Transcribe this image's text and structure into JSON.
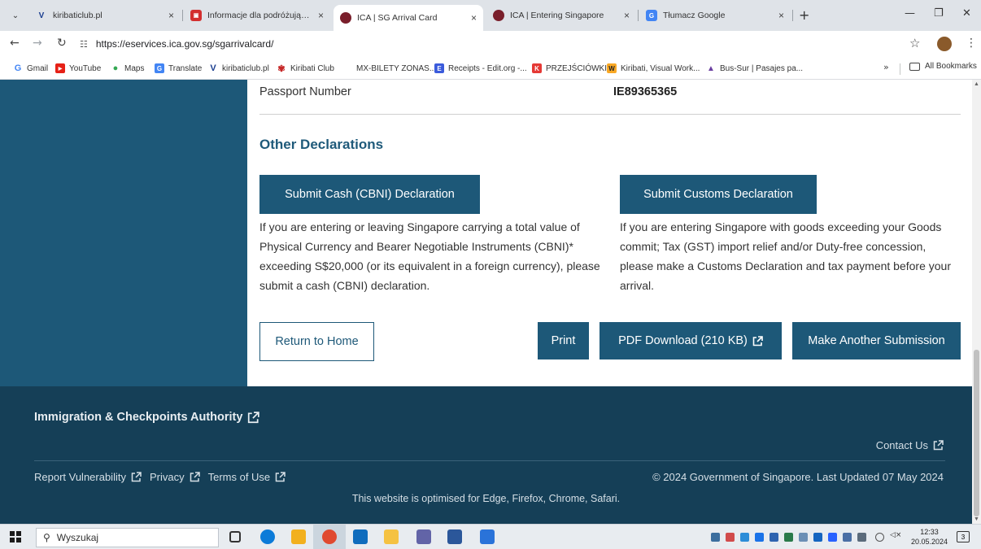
{
  "browser": {
    "tabs": [
      {
        "title": "kiribaticlub.pl",
        "close": "×"
      },
      {
        "title": "Informacje dla podróżujących",
        "close": "×"
      },
      {
        "title": "ICA | SG Arrival Card",
        "close": "×",
        "active": true
      },
      {
        "title": "ICA | Entering Singapore",
        "close": "×"
      },
      {
        "title": "Tłumacz Google",
        "close": "×"
      }
    ],
    "new_tab": "+",
    "url": "https://eservices.ica.gov.sg/sgarrivalcard/",
    "bookmarks": [
      "Gmail",
      "YouTube",
      "Maps",
      "Translate",
      "kiribaticlub.pl",
      "Kiribati Club",
      "MX-BILETY ZONAS...",
      "Receipts - Edit.org -...",
      "PRZEJŚCIÓWKI",
      "Kiribati, Visual Work...",
      "Bus-Sur | Pasajes pa..."
    ],
    "bookmarks_more": "»",
    "all_bookmarks": "All Bookmarks"
  },
  "page": {
    "passport_label": "Passport Number",
    "passport_value": "IE89365365",
    "declarations_title": "Other Declarations",
    "cbni_button": "Submit Cash (CBNI) Declaration",
    "cbni_text": "If you are entering or leaving Singapore carrying a total value of Physical Currency and Bearer Negotiable Instruments (CBNI)* exceeding S$20,000 (or its equivalent in a foreign currency), please submit a cash (CBNI) declaration.",
    "customs_button": "Submit Customs Declaration",
    "customs_text": "If you are entering Singapore with goods exceeding your Goods commit; Tax (GST) import relief and/or Duty-free concession, please make a Customs Declaration and tax payment before your arrival.",
    "return_button": "Return to Home",
    "print_button": "Print",
    "pdf_button": "PDF Download  (210 KB)",
    "another_button": "Make Another Submission"
  },
  "footer": {
    "authority": "Immigration & Checkpoints Authority",
    "contact": "Contact Us",
    "links": [
      "Report Vulnerability",
      "Privacy",
      "Terms of Use"
    ],
    "copyright": "© 2024 Government of Singapore.  Last Updated 07 May 2024",
    "optimised": "This website is optimised for Edge, Firefox, Chrome, Safari."
  },
  "taskbar": {
    "search_placeholder": "Wyszukaj",
    "time": "12:33",
    "date": "20.05.2024",
    "notifications": "3"
  },
  "colors": {
    "brand": "#1d5878",
    "footer": "#153f57"
  }
}
